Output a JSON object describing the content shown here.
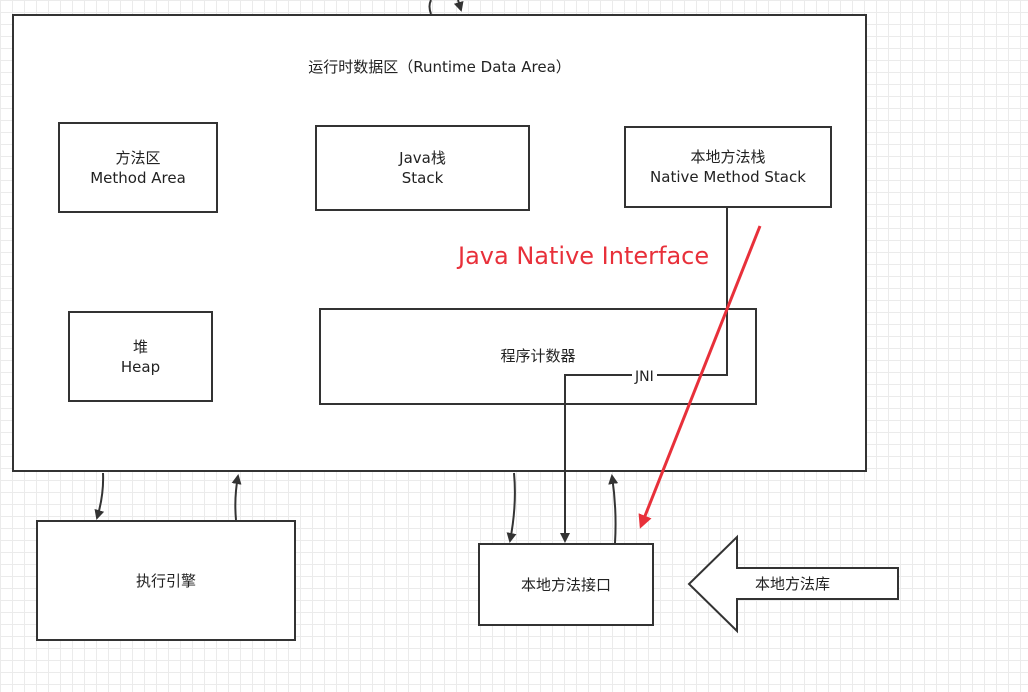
{
  "diagram": {
    "runtime_area": {
      "title": "运行时数据区（Runtime Data Area）"
    },
    "method_area": {
      "line1": "方法区",
      "line2": "Method Area"
    },
    "java_stack": {
      "line1": "Java栈",
      "line2": "Stack"
    },
    "native_stack": {
      "line1": "本地方法栈",
      "line2": "Native Method Stack"
    },
    "heap": {
      "line1": "堆",
      "line2": "Heap"
    },
    "pc_register": {
      "label": "程序计数器"
    },
    "jni_label": "JNI",
    "annotation": "Java Native Interface",
    "execution_engine": {
      "label": "执行引擎"
    },
    "native_interface": {
      "label": "本地方法接口"
    },
    "native_library": {
      "label": "本地方法库"
    },
    "colors": {
      "stroke": "#333333",
      "annotation": "#e8303a",
      "grid": "#ebebeb"
    }
  }
}
